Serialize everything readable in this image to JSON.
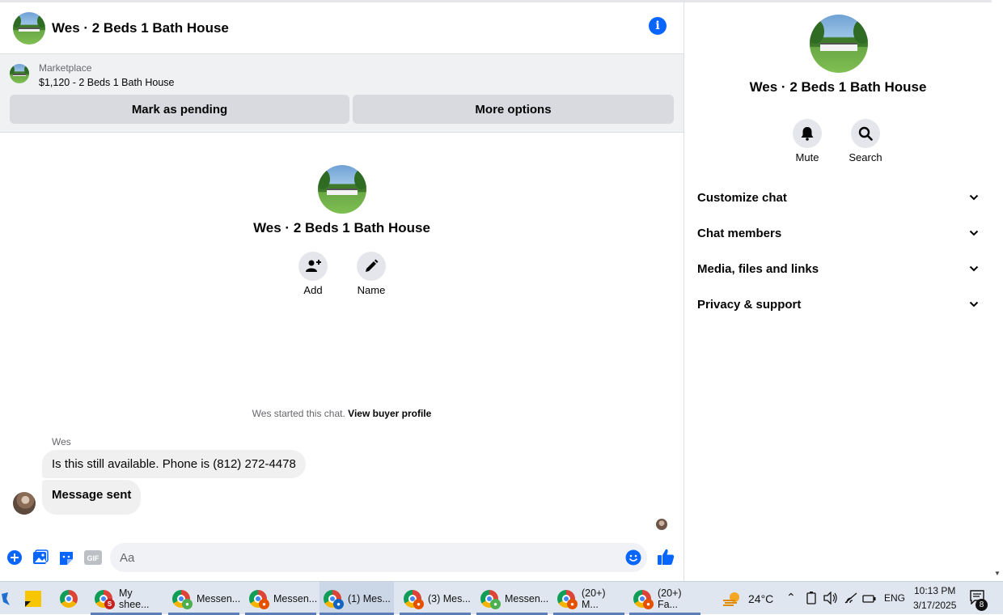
{
  "chat": {
    "title": "Wes · 2 Beds 1 Bath House",
    "info_icon": "info-icon"
  },
  "marketplace": {
    "label": "Marketplace",
    "listing": "$1,120 - 2 Beds 1 Bath House",
    "pending_button": "Mark as pending",
    "more_button": "More options"
  },
  "intro": {
    "title": "Wes · 2 Beds 1 Bath House",
    "add_label": "Add",
    "name_label": "Name"
  },
  "conversation": {
    "system_prefix": "Wes started this chat.",
    "system_link": "View buyer profile",
    "sender": "Wes",
    "messages": [
      "Is this still available. Phone is (812) 272-4478",
      "Message sent"
    ]
  },
  "composer": {
    "placeholder": "Aa"
  },
  "details": {
    "title": "Wes · 2 Beds 1 Bath House",
    "actions": [
      "Mute",
      "Search"
    ],
    "sections": [
      "Customize chat",
      "Chat members",
      "Media, files and links",
      "Privacy & support"
    ]
  },
  "taskbar": {
    "apps": [
      {
        "label": "My shee...",
        "active": false
      },
      {
        "label": "Messen...",
        "active": false
      },
      {
        "label": "Messen...",
        "active": false
      },
      {
        "label": "(1) Mes...",
        "active": true
      },
      {
        "label": "(3) Mes...",
        "active": false
      },
      {
        "label": "Messen...",
        "active": false
      },
      {
        "label": "(20+) M...",
        "active": false
      },
      {
        "label": "(20+) Fa...",
        "active": false
      }
    ],
    "weather": "24°C",
    "language": "ENG",
    "time": "10:13 PM",
    "date": "3/17/2025",
    "notification_count": "8"
  },
  "colors": {
    "accent": "#0866ff",
    "bubble": "#f0f0f0",
    "button": "#d8dadf"
  }
}
